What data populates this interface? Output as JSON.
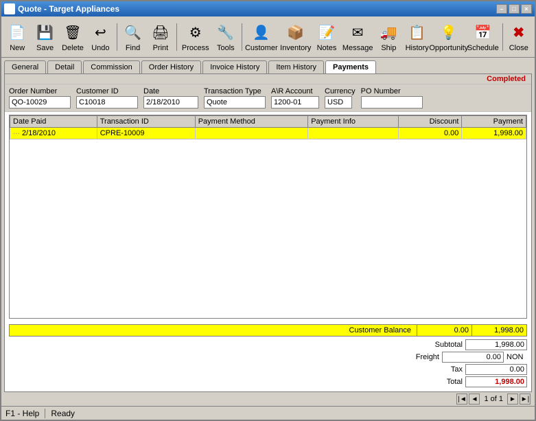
{
  "window": {
    "title": "Quote - Target Appliances",
    "status": "Completed"
  },
  "toolbar": {
    "buttons": [
      {
        "id": "new",
        "label": "New",
        "icon": "📄"
      },
      {
        "id": "save",
        "label": "Save",
        "icon": "💾"
      },
      {
        "id": "delete",
        "label": "Delete",
        "icon": "🗑"
      },
      {
        "id": "undo",
        "label": "Undo",
        "icon": "↩"
      },
      {
        "id": "find",
        "label": "Find",
        "icon": "🔍"
      },
      {
        "id": "print",
        "label": "Print",
        "icon": "🖨"
      },
      {
        "id": "process",
        "label": "Process",
        "icon": "⚙"
      },
      {
        "id": "tools",
        "label": "Tools",
        "icon": "🔧"
      },
      {
        "id": "customer",
        "label": "Customer",
        "icon": "👤"
      },
      {
        "id": "inventory",
        "label": "Inventory",
        "icon": "📦"
      },
      {
        "id": "notes",
        "label": "Notes",
        "icon": "📝"
      },
      {
        "id": "message",
        "label": "Message",
        "icon": "✉"
      },
      {
        "id": "ship",
        "label": "Ship",
        "icon": "🚚"
      },
      {
        "id": "history",
        "label": "History",
        "icon": "📋"
      },
      {
        "id": "opportunity",
        "label": "Opportunity",
        "icon": "💡"
      },
      {
        "id": "schedule",
        "label": "Schedule",
        "icon": "📅"
      },
      {
        "id": "close",
        "label": "Close",
        "icon": "✖"
      }
    ]
  },
  "tabs": [
    {
      "id": "general",
      "label": "General",
      "active": false
    },
    {
      "id": "detail",
      "label": "Detail",
      "active": false
    },
    {
      "id": "commission",
      "label": "Commission",
      "active": false
    },
    {
      "id": "order-history",
      "label": "Order History",
      "active": false
    },
    {
      "id": "invoice-history",
      "label": "Invoice History",
      "active": false
    },
    {
      "id": "item-history",
      "label": "Item History",
      "active": false
    },
    {
      "id": "payments",
      "label": "Payments",
      "active": true
    }
  ],
  "form": {
    "order_number_label": "Order Number",
    "order_number_value": "QO-10029",
    "customer_id_label": "Customer ID",
    "customer_id_value": "C10018",
    "date_label": "Date",
    "date_value": "2/18/2010",
    "transaction_type_label": "Transaction Type",
    "transaction_type_value": "Quote",
    "ar_account_label": "A\\R Account",
    "ar_account_value": "1200-01",
    "currency_label": "Currency",
    "currency_value": "USD",
    "po_number_label": "PO Number",
    "po_number_value": ""
  },
  "table": {
    "columns": [
      {
        "id": "date-paid",
        "label": "Date Paid"
      },
      {
        "id": "transaction-id",
        "label": "Transaction ID"
      },
      {
        "id": "payment-method",
        "label": "Payment Method"
      },
      {
        "id": "payment-info",
        "label": "Payment Info"
      },
      {
        "id": "discount",
        "label": "Discount"
      },
      {
        "id": "payment",
        "label": "Payment"
      }
    ],
    "rows": [
      {
        "date_paid": "2/18/2010",
        "transaction_id": "CPRE-10009",
        "payment_method": "",
        "payment_info": "",
        "discount": "0.00",
        "payment": "1,998.00",
        "highlighted": true
      }
    ]
  },
  "balance": {
    "label": "Customer Balance",
    "discount": "0.00",
    "amount": "1,998.00"
  },
  "totals": {
    "subtotal_label": "Subtotal",
    "subtotal_value": "1,998.00",
    "freight_label": "Freight",
    "freight_value": "0.00",
    "freight_suffix": "NON",
    "tax_label": "Tax",
    "tax_value": "0.00",
    "total_label": "Total",
    "total_value": "1,998.00"
  },
  "statusbar": {
    "help": "F1 - Help",
    "ready": "Ready"
  },
  "pagination": {
    "page_info": "1 of 1"
  }
}
